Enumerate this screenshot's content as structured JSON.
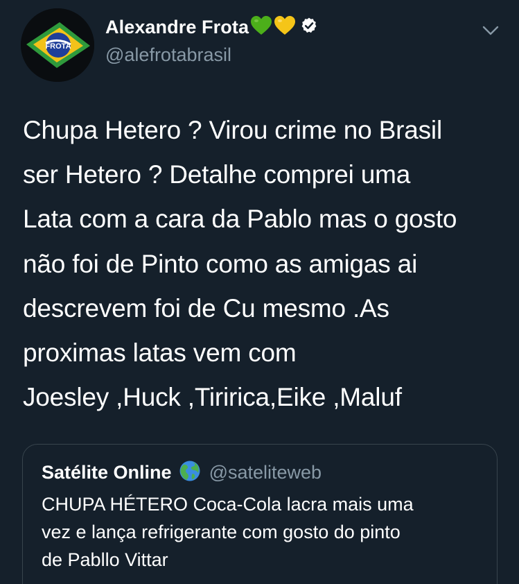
{
  "author": {
    "display_name": "Alexandre Frota",
    "handle": "@alefrotabrasil",
    "avatar_text": "FROTA"
  },
  "tweet": {
    "lines": [
      "Chupa Hetero ? Virou crime no Brasil",
      "ser Hetero ? Detalhe comprei uma",
      "Lata  com a cara da Pablo mas o gosto",
      "não foi de Pinto como as amigas ai",
      "descrevem foi de Cu mesmo .As",
      "proximas latas vem com",
      "Joesley ,Huck ,Tiririca,Eike ,Maluf"
    ]
  },
  "quoted": {
    "display_name": "Satélite Online",
    "handle": "@sateliteweb",
    "lines": [
      "CHUPA HÉTERO Coca-Cola lacra mais uma",
      "vez e lança refrigerante com gosto do pinto",
      "de Pabllo Vittar"
    ]
  },
  "icons": {
    "emoji_1": "green-heart-icon",
    "emoji_2": "yellow-heart-icon",
    "verified": "verified-badge-icon",
    "caret": "chevron-down-icon",
    "globe": "globe-americas-icon"
  },
  "colors": {
    "background": "#15202b",
    "text": "#ffffff",
    "secondary_text": "#8899a6",
    "border": "#38444d",
    "green_heart": "#4caf1a",
    "yellow_heart": "#f5c518"
  }
}
